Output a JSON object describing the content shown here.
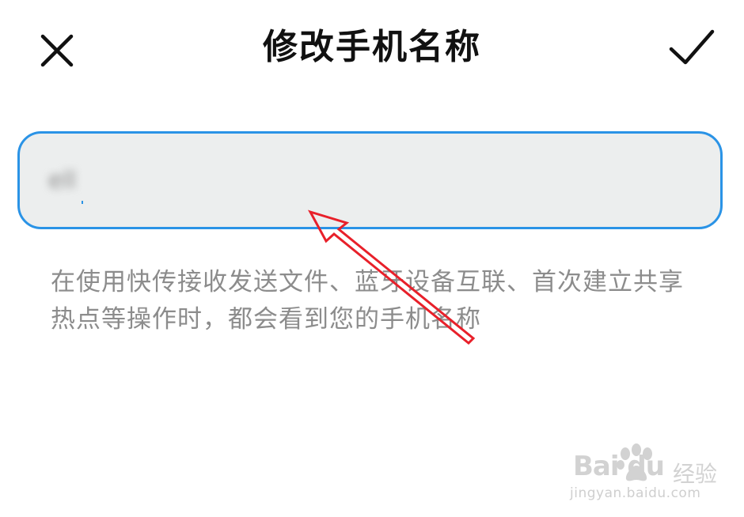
{
  "header": {
    "title": "修改手机名称",
    "close_icon": "close-icon",
    "confirm_icon": "check-icon"
  },
  "input": {
    "value": "ell",
    "border_color": "#2a93e6",
    "background_color": "#eceeee"
  },
  "description": "在使用快传接收发送文件、蓝牙设备互联、首次建立共享热点等操作时，都会看到您的手机名称",
  "annotation": {
    "arrow_color": "#e8202a"
  },
  "watermark": {
    "brand": "Bai du",
    "cn": "经验",
    "url": "jingyan.baidu.com"
  }
}
